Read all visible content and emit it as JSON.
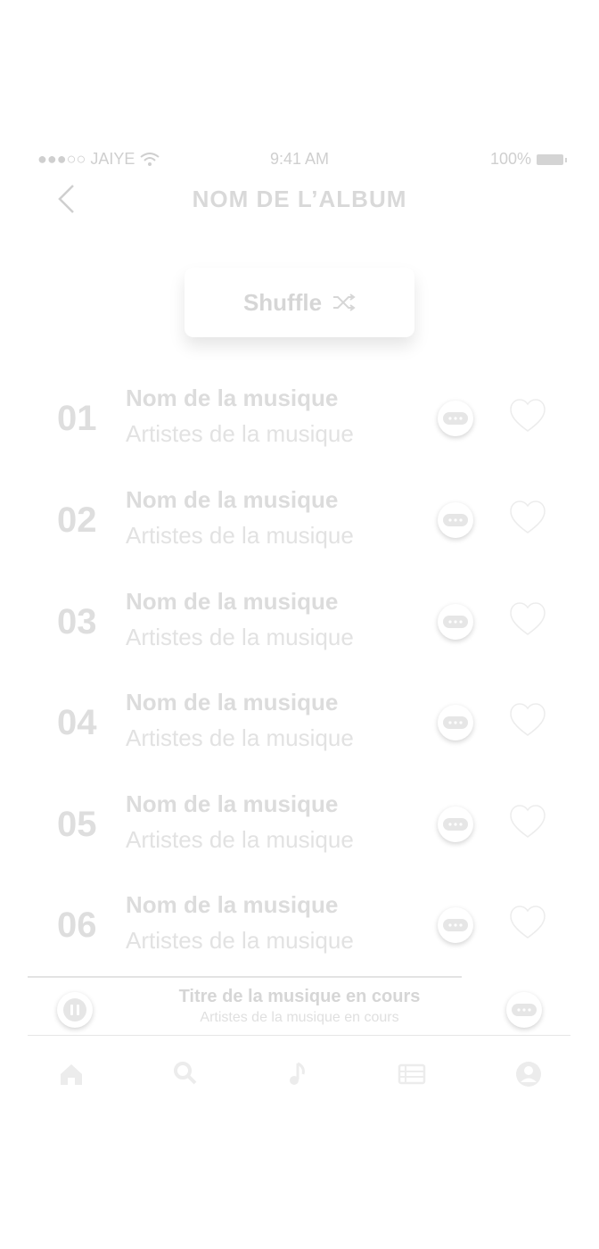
{
  "status_bar": {
    "carrier": "●●●○○ JAIYE",
    "time": "9:41 AM",
    "battery": "100%"
  },
  "header": {
    "title": "NOM DE L’ALBUM",
    "back_icon": "chevron-left-icon"
  },
  "shuffle": {
    "label": "Shuffle",
    "icon": "shuffle-icon"
  },
  "tracks": [
    {
      "number": "01",
      "title": "Nom de la musique",
      "artist": "Artistes de la musique"
    },
    {
      "number": "02",
      "title": "Nom de la musique",
      "artist": "Artistes de la musique"
    },
    {
      "number": "03",
      "title": "Nom de la musique",
      "artist": "Artistes de la musique"
    },
    {
      "number": "04",
      "title": "Nom de la musique",
      "artist": "Artistes de la musique"
    },
    {
      "number": "05",
      "title": "Nom de la musique",
      "artist": "Artistes de la musique"
    },
    {
      "number": "06",
      "title": "Nom de la musique",
      "artist": "Artistes de la musique"
    }
  ],
  "now_playing": {
    "title": "Titre de la musique en cours",
    "artist": "Artistes de la musique en cours",
    "progress": 0.8
  },
  "tab_bar": {
    "items": [
      "home-icon",
      "search-icon",
      "music-note-icon",
      "list-icon",
      "profile-icon"
    ]
  },
  "colors": {
    "text": "#d9d9d9",
    "background": "#ffffff"
  }
}
